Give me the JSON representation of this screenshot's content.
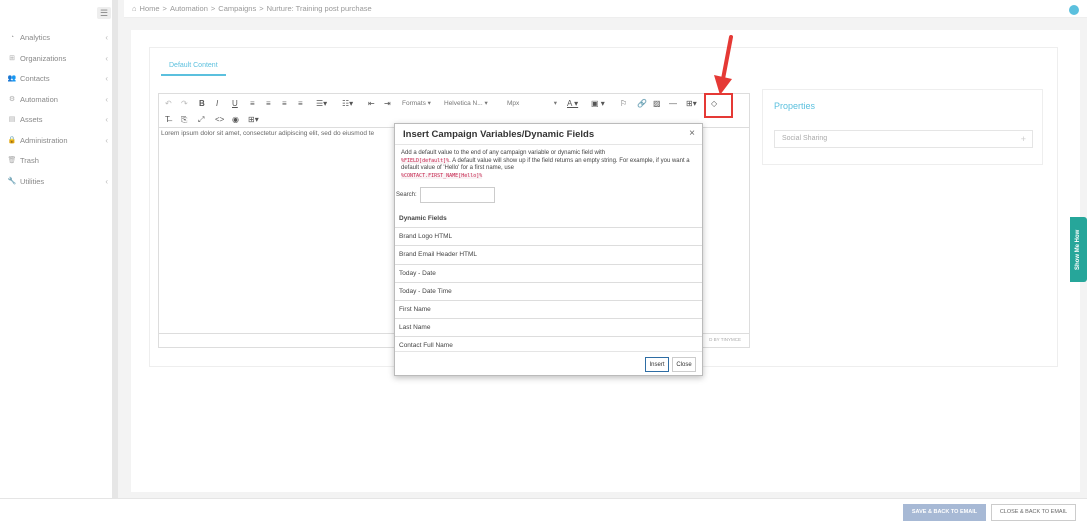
{
  "sidebar": {
    "items": [
      {
        "label": "Analytics",
        "icon": "chart-icon",
        "chevron": true
      },
      {
        "label": "Organizations",
        "icon": "sitemap-icon",
        "chevron": true
      },
      {
        "label": "Contacts",
        "icon": "users-icon",
        "chevron": true
      },
      {
        "label": "Automation",
        "icon": "cogs-icon",
        "chevron": true
      },
      {
        "label": "Assets",
        "icon": "list-icon",
        "chevron": true
      },
      {
        "label": "Administration",
        "icon": "lock-icon",
        "chevron": true
      },
      {
        "label": "Trash",
        "icon": "trash-icon",
        "chevron": false
      },
      {
        "label": "Utilities",
        "icon": "wrench-icon",
        "chevron": true
      }
    ]
  },
  "breadcrumb": {
    "items": [
      "Home",
      "Automation",
      "Campaigns",
      "Nurture: Training post purchase"
    ],
    "separator": ">"
  },
  "tab": {
    "label": "Default Content"
  },
  "editor": {
    "formats_label": "Formats",
    "font_label": "Helvetica N...",
    "size_label": "Mpx",
    "body_text": "Lorem ipsum dolor sit amet, consectetur adipiscing elit, sed do eiusmod te",
    "powered_by": "D BY TINYMCE"
  },
  "properties": {
    "title": "Properties",
    "social_sharing": "Social Sharing",
    "plus": "+"
  },
  "show_me_how": "Show Me How",
  "footer": {
    "save_label": "SAVE & BACK TO EMAIL",
    "close_label": "CLOSE & BACK TO EMAIL"
  },
  "modal": {
    "title": "Insert Campaign Variables/Dynamic Fields",
    "close_symbol": "×",
    "desc_1": "Add a default value to the end of any campaign variable or dynamic field with",
    "code_1": "%FIELD[default]%",
    "desc_2": ". A default value will show up if the field returns an empty string. For example, if you want a default value of 'Hello' for a first name, use",
    "code_2": "%CONTACT.FIRST_NAME[Hello]%",
    "search_label": "Search:",
    "search_value": "",
    "list_header": "Dynamic Fields",
    "list_items": [
      "Brand Logo HTML",
      "Brand Email Header HTML",
      "Today - Date",
      "Today - Date Time",
      "First Name",
      "Last Name",
      "Contact Full Name"
    ],
    "insert_label": "Insert",
    "close_label": "Close"
  },
  "colors": {
    "accent": "#5bc0de",
    "highlight": "#e53935",
    "show_me_how": "#26a69a",
    "save_button": "#a7b9d5"
  }
}
